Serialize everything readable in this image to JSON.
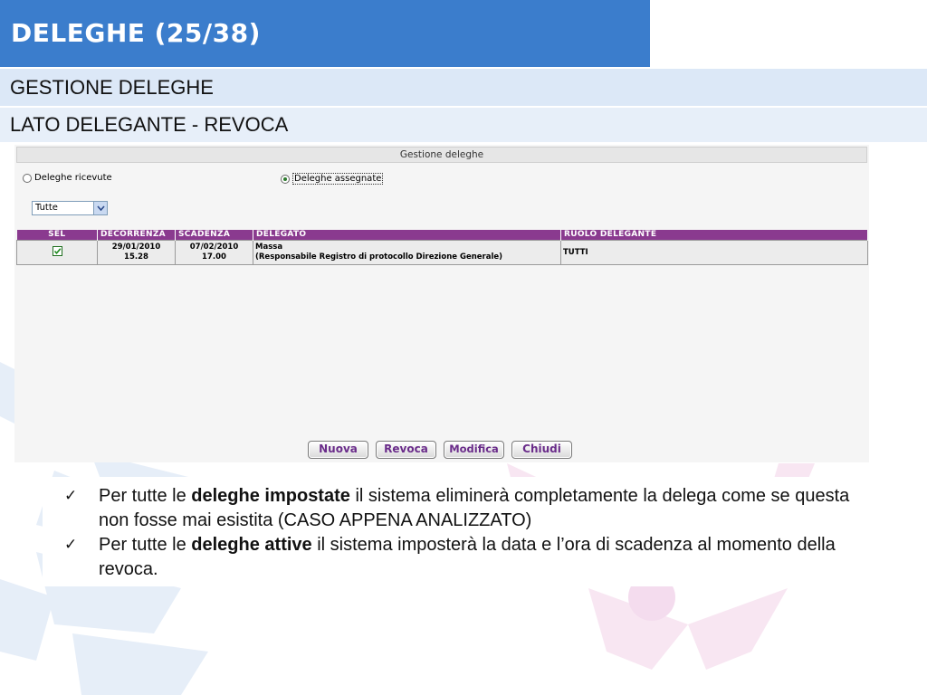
{
  "slide": {
    "title": "DELEGHE (25/38)",
    "section": "GESTIONE DELEGHE",
    "subsection": "LATO DELEGANTE - REVOCA"
  },
  "app": {
    "header": "Gestione deleghe",
    "radio_received": "Deleghe ricevute",
    "radio_assigned": "Deleghe assegnate",
    "selected_radio": "assigned",
    "filter_value": "Tutte",
    "table": {
      "columns": [
        "SEL",
        "DECORRENZA",
        "SCADENZA",
        "DELEGATO",
        "RUOLO DELEGANTE"
      ],
      "rows": [
        {
          "sel": true,
          "decorrenza_date": "29/01/2010",
          "decorrenza_time": "15.28",
          "scadenza_date": "07/02/2010",
          "scadenza_time": "17.00",
          "delegato_name": "Massa",
          "delegato_role": "(Responsabile Registro di protocollo Direzione Generale)",
          "ruolo": "TUTTI"
        }
      ]
    },
    "buttons": {
      "nuova": "Nuova",
      "revoca": "Revoca",
      "modifica": "Modifica",
      "chiudi": "Chiudi"
    }
  },
  "notes": [
    {
      "prefix": "Per tutte le ",
      "bold": "deleghe impostate",
      "suffix": " il sistema eliminerà completamente la delega come se questa non fosse mai esistita (CASO APPENA  ANALIZZATO)"
    },
    {
      "prefix": "Per tutte le ",
      "bold": "deleghe attive",
      "suffix": " il sistema imposterà la data e l’ora di scadenza al momento della revoca."
    }
  ],
  "icons": {
    "bullet": "check-icon",
    "dropdown": "chevron-down-icon",
    "checkbox": "checkbox-checked-icon"
  },
  "colors": {
    "title_bar": "#3b7dcc",
    "band": "#dce8f7",
    "table_header": "#8a3a8f",
    "button_text": "#6a2c8a"
  }
}
